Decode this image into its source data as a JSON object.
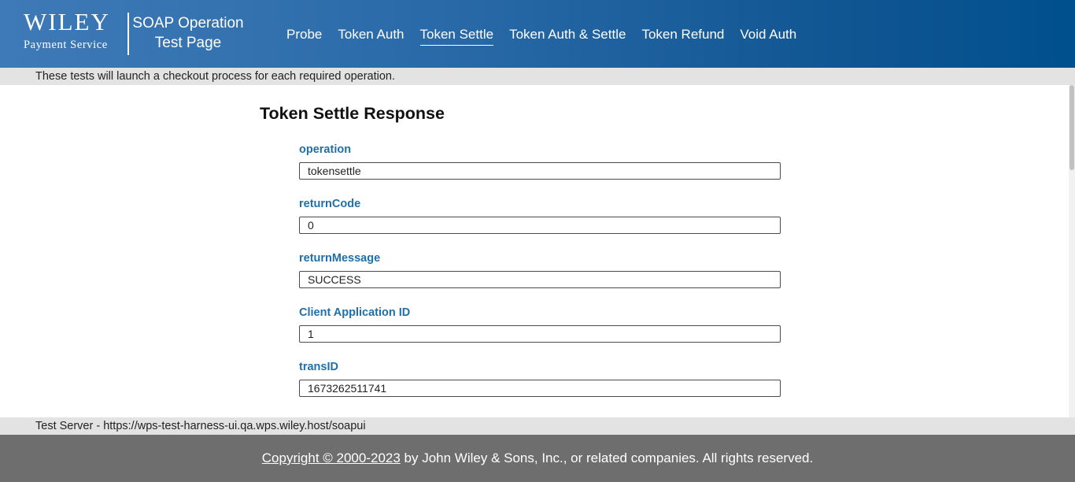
{
  "header": {
    "logo_word": "WILEY",
    "logo_sub": "Payment Service",
    "title_line1": "SOAP Operation",
    "title_line2": "Test Page",
    "nav": [
      {
        "label": "Probe"
      },
      {
        "label": "Token Auth"
      },
      {
        "label": "Token Settle",
        "active": true
      },
      {
        "label": "Token Auth & Settle"
      },
      {
        "label": "Token Refund"
      },
      {
        "label": "Void Auth"
      }
    ]
  },
  "info_top": "These tests will launch a checkout process for each required operation.",
  "main": {
    "title": "Token Settle Response",
    "fields": [
      {
        "label": "operation",
        "value": "tokensettle"
      },
      {
        "label": "returnCode",
        "value": "0"
      },
      {
        "label": "returnMessage",
        "value": "SUCCESS"
      },
      {
        "label": "Client Application ID",
        "value": "1"
      },
      {
        "label": "transID",
        "value": "1673262511741"
      }
    ]
  },
  "info_bottom": "Test Server - https://wps-test-harness-ui.qa.wps.wiley.host/soapui",
  "footer": {
    "copyright_link": "Copyright © 2000-2023",
    "copyright_rest": " by John Wiley & Sons, Inc., or related companies. All rights reserved."
  },
  "colors": {
    "header_gradient_start": "#3f7ab8",
    "header_gradient_end": "#00508e",
    "label_blue": "#1f6fa8",
    "bar_gray": "#e3e3e3",
    "footer_gray": "#6e6e6e"
  }
}
